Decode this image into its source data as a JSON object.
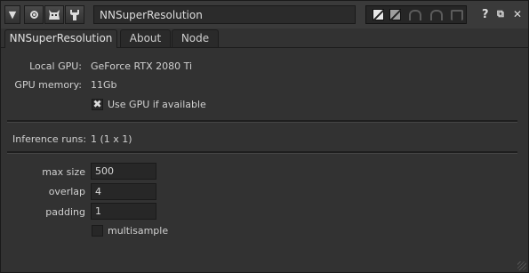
{
  "toolbar": {
    "node_name": "NNSuperResolution",
    "help_label": "?",
    "float_label": "⧉",
    "close_label": "✕"
  },
  "tabs": [
    {
      "label": "NNSuperResolution",
      "active": true
    },
    {
      "label": "About",
      "active": false
    },
    {
      "label": "Node",
      "active": false
    }
  ],
  "info": {
    "local_gpu_label": "Local GPU:",
    "local_gpu_value": "GeForce RTX 2080 Ti",
    "gpu_memory_label": "GPU memory:",
    "gpu_memory_value": "11Gb",
    "use_gpu_label": "Use GPU if available",
    "use_gpu_checked": true,
    "inference_label": "Inference runs:",
    "inference_value": "1 (1 x 1)"
  },
  "params": {
    "max_size_label": "max size",
    "max_size_value": "500",
    "overlap_label": "overlap",
    "overlap_value": "4",
    "padding_label": "padding",
    "padding_value": "1",
    "multisample_label": "multisample",
    "multisample_checked": false
  },
  "icons": {
    "collapse": "triangle-down-icon",
    "viewer": "circle-dot-icon",
    "monster": "monster-icon",
    "wrench": "wrench-icon",
    "undo": "undo-icon",
    "redo": "redo-icon",
    "revert": "revert-icon"
  }
}
